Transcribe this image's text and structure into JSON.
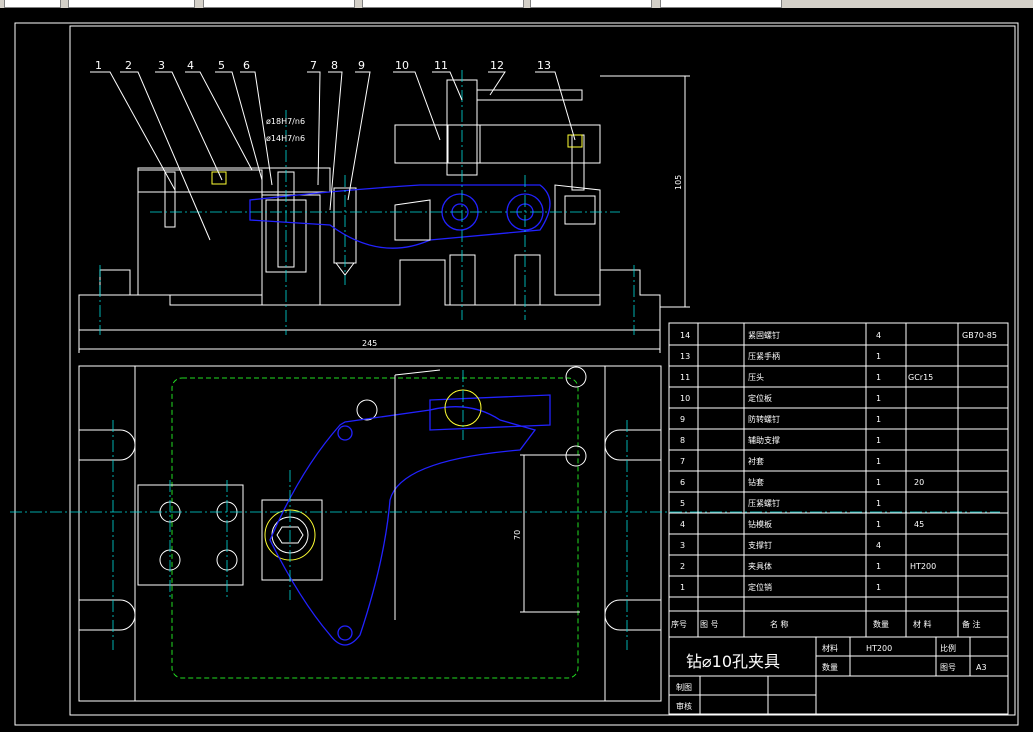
{
  "window": {
    "background": "#000000",
    "line_color": "#ffffff",
    "accent_blue": "#2222ff",
    "accent_green": "#22dd22",
    "accent_magenta": "#dd00dd",
    "center_line": "#00dddd"
  },
  "part_labels": [
    "1",
    "2",
    "3",
    "4",
    "5",
    "6",
    "7",
    "8",
    "9",
    "10",
    "11",
    "12",
    "13"
  ],
  "fit_labels": [
    "ø18H7/n6",
    "ø14H7/n6"
  ],
  "dimensions": {
    "height": "105",
    "width": "245",
    "offset": "70"
  },
  "bom": {
    "rows": [
      {
        "no": "14",
        "name": "紧固螺钉",
        "qty": "4",
        "material": "",
        "note": "GB70-85"
      },
      {
        "no": "13",
        "name": "压紧手柄",
        "qty": "1",
        "material": "",
        "note": ""
      },
      {
        "no": "11",
        "name": "压头",
        "qty": "1",
        "material": "GCr15",
        "note": ""
      },
      {
        "no": "10",
        "name": "定位板",
        "qty": "1",
        "material": "",
        "note": ""
      },
      {
        "no": "9",
        "name": "防转螺钉",
        "qty": "1",
        "material": "",
        "note": ""
      },
      {
        "no": "8",
        "name": "辅助支撑",
        "qty": "1",
        "material": "",
        "note": ""
      },
      {
        "no": "7",
        "name": "衬套",
        "qty": "1",
        "material": "",
        "note": ""
      },
      {
        "no": "6",
        "name": "钻套",
        "qty": "1",
        "material": "20",
        "note": ""
      },
      {
        "no": "5",
        "name": "压紧螺钉",
        "qty": "1",
        "material": "",
        "note": ""
      },
      {
        "no": "4",
        "name": "钻模板",
        "qty": "1",
        "material": "45",
        "note": ""
      },
      {
        "no": "3",
        "name": "支撑钉",
        "qty": "4",
        "material": "",
        "note": ""
      },
      {
        "no": "2",
        "name": "夹具体",
        "qty": "1",
        "material": "HT200",
        "note": ""
      },
      {
        "no": "1",
        "name": "定位销",
        "qty": "1",
        "material": "",
        "note": ""
      }
    ],
    "header": {
      "no": "序号",
      "code": "图 号",
      "name": "名    称",
      "qty": "数量",
      "material": "材 料",
      "note": "备 注"
    }
  },
  "title_block": {
    "title": "钻⌀10孔夹具",
    "material_label": "材料",
    "material_value": "HT200",
    "scale_label": "比例",
    "qty_label": "数量",
    "drawing_no_label": "图号",
    "sheet_size": "A3",
    "drawn_label": "制图",
    "checked_label": "审核"
  }
}
